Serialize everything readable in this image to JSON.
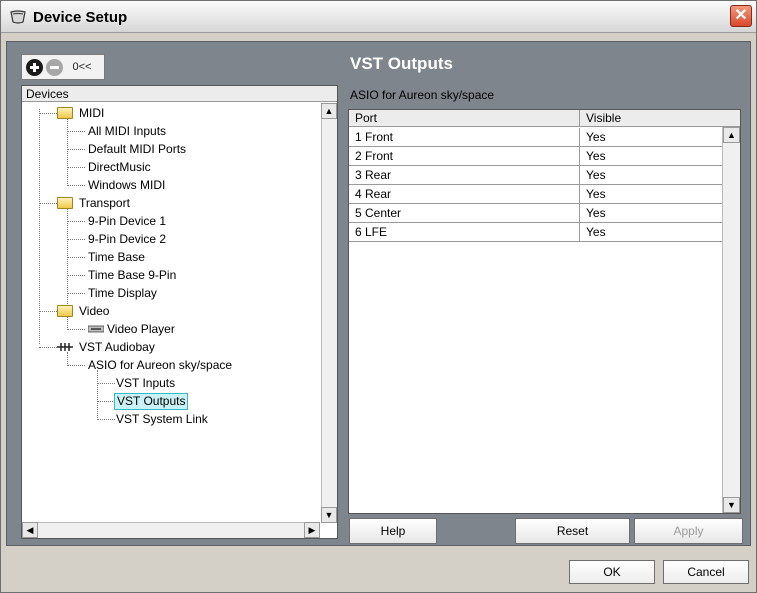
{
  "window": {
    "title": "Device Setup",
    "close_glyph": "✕"
  },
  "toolbar": {
    "add_icon": "plus-circle-icon",
    "remove_icon": "minus-circle-icon",
    "reset_label": "0<<"
  },
  "devices": {
    "header": "Devices",
    "tree": [
      {
        "label": "MIDI",
        "type": "folder",
        "level": 1
      },
      {
        "label": "All MIDI Inputs",
        "type": "leaf",
        "level": 2
      },
      {
        "label": "Default MIDI Ports",
        "type": "leaf",
        "level": 2
      },
      {
        "label": "DirectMusic",
        "type": "leaf",
        "level": 2
      },
      {
        "label": "Windows MIDI",
        "type": "leaf",
        "level": 2
      },
      {
        "label": "Transport",
        "type": "folder",
        "level": 1
      },
      {
        "label": "9-Pin Device 1",
        "type": "leaf",
        "level": 2
      },
      {
        "label": "9-Pin Device 2",
        "type": "leaf",
        "level": 2
      },
      {
        "label": "Time Base",
        "type": "leaf",
        "level": 2
      },
      {
        "label": "Time Base 9-Pin",
        "type": "leaf",
        "level": 2
      },
      {
        "label": "Time Display",
        "type": "leaf",
        "level": 2
      },
      {
        "label": "Video",
        "type": "folder",
        "level": 1
      },
      {
        "label": "Video Player",
        "type": "leaf",
        "level": 2
      },
      {
        "label": "VST Audiobay",
        "type": "audiobay",
        "level": 1
      },
      {
        "label": "ASIO for Aureon sky/space",
        "type": "leaf",
        "level": 2
      },
      {
        "label": "VST Inputs",
        "type": "leaf",
        "level": 3
      },
      {
        "label": "VST Outputs",
        "type": "leaf",
        "level": 3,
        "selected": true
      },
      {
        "label": "VST System Link",
        "type": "leaf",
        "level": 3
      }
    ]
  },
  "panel": {
    "title": "VST Outputs",
    "subtitle": "ASIO for Aureon sky/space",
    "columns": [
      "Port",
      "Visible"
    ],
    "rows": [
      {
        "port": "1 Front",
        "visible": "Yes"
      },
      {
        "port": "2 Front",
        "visible": "Yes"
      },
      {
        "port": "3 Rear",
        "visible": "Yes"
      },
      {
        "port": "4 Rear",
        "visible": "Yes"
      },
      {
        "port": "5 Center",
        "visible": "Yes"
      },
      {
        "port": "6 LFE",
        "visible": "Yes"
      }
    ],
    "help_label": "Help",
    "reset_label": "Reset",
    "apply_label": "Apply"
  },
  "footer": {
    "ok_label": "OK",
    "cancel_label": "Cancel"
  },
  "scroll": {
    "up": "▲",
    "down": "▼",
    "left": "◀",
    "right": "▶"
  }
}
